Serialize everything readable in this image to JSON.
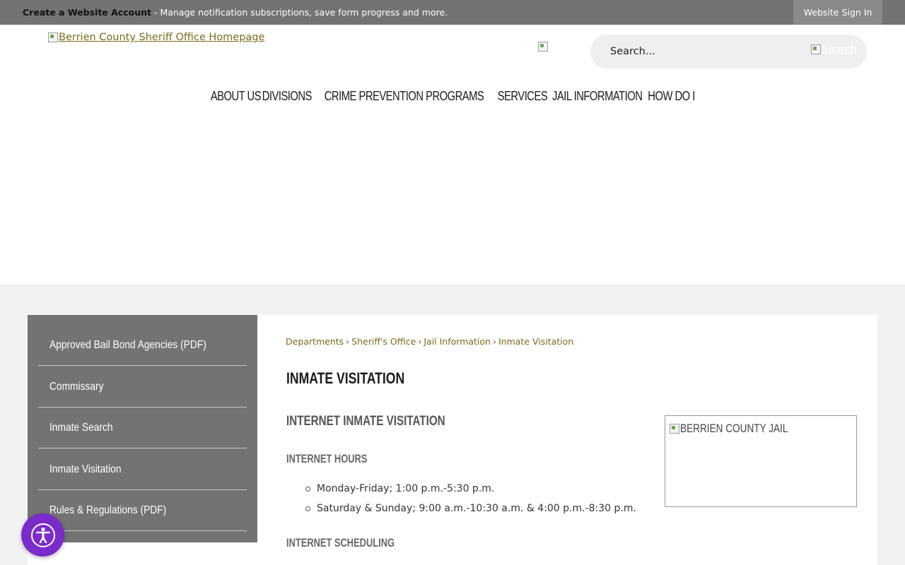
{
  "topbar": {
    "create_account_label": "Create a Website Account",
    "create_account_text": " - Manage notification subscriptions, save form progress and more.",
    "sign_in_label": "Website Sign In"
  },
  "header": {
    "logo_alt": "Berrien County Sheriff Office Homepage",
    "search": {
      "placeholder": "Search...",
      "button_label": "Search"
    }
  },
  "mainnav": {
    "items": [
      {
        "label": "About Us"
      },
      {
        "label": "Divisions"
      },
      {
        "label": "Crime Prevention Programs"
      },
      {
        "label": "Services"
      },
      {
        "label": "Jail Information"
      },
      {
        "label": "How Do I"
      }
    ]
  },
  "sidebar": {
    "items": [
      {
        "label": "Approved Bail Bond Agencies (PDF)"
      },
      {
        "label": "Commissary"
      },
      {
        "label": "Inmate Search"
      },
      {
        "label": "Inmate Visitation"
      },
      {
        "label": "Rules & Regulations (PDF)"
      }
    ]
  },
  "breadcrumb": {
    "items": [
      {
        "label": "Departments"
      },
      {
        "label": "Sheriff's Office"
      },
      {
        "label": "Jail Information"
      },
      {
        "label": "Inmate Visitation"
      }
    ],
    "separator": "›"
  },
  "content": {
    "page_title": "Inmate Visitation",
    "section_title": "Internet Inmate Visitation",
    "hours_heading": "Internet Hours",
    "hours": [
      "Monday-Friday; 1:00 p.m.-5:30 p.m.",
      "Saturday & Sunday; 9:00 a.m.-10:30 a.m. & 4:00 p.m.-8:30 p.m."
    ],
    "scheduling_heading": "Internet Scheduling",
    "image_alt": "Berrien County Jail"
  },
  "colors": {
    "topbar": "#737373",
    "sidebar": "#737373",
    "link": "#7a6a1e",
    "accessibility_widget": "#7b2bc9"
  }
}
